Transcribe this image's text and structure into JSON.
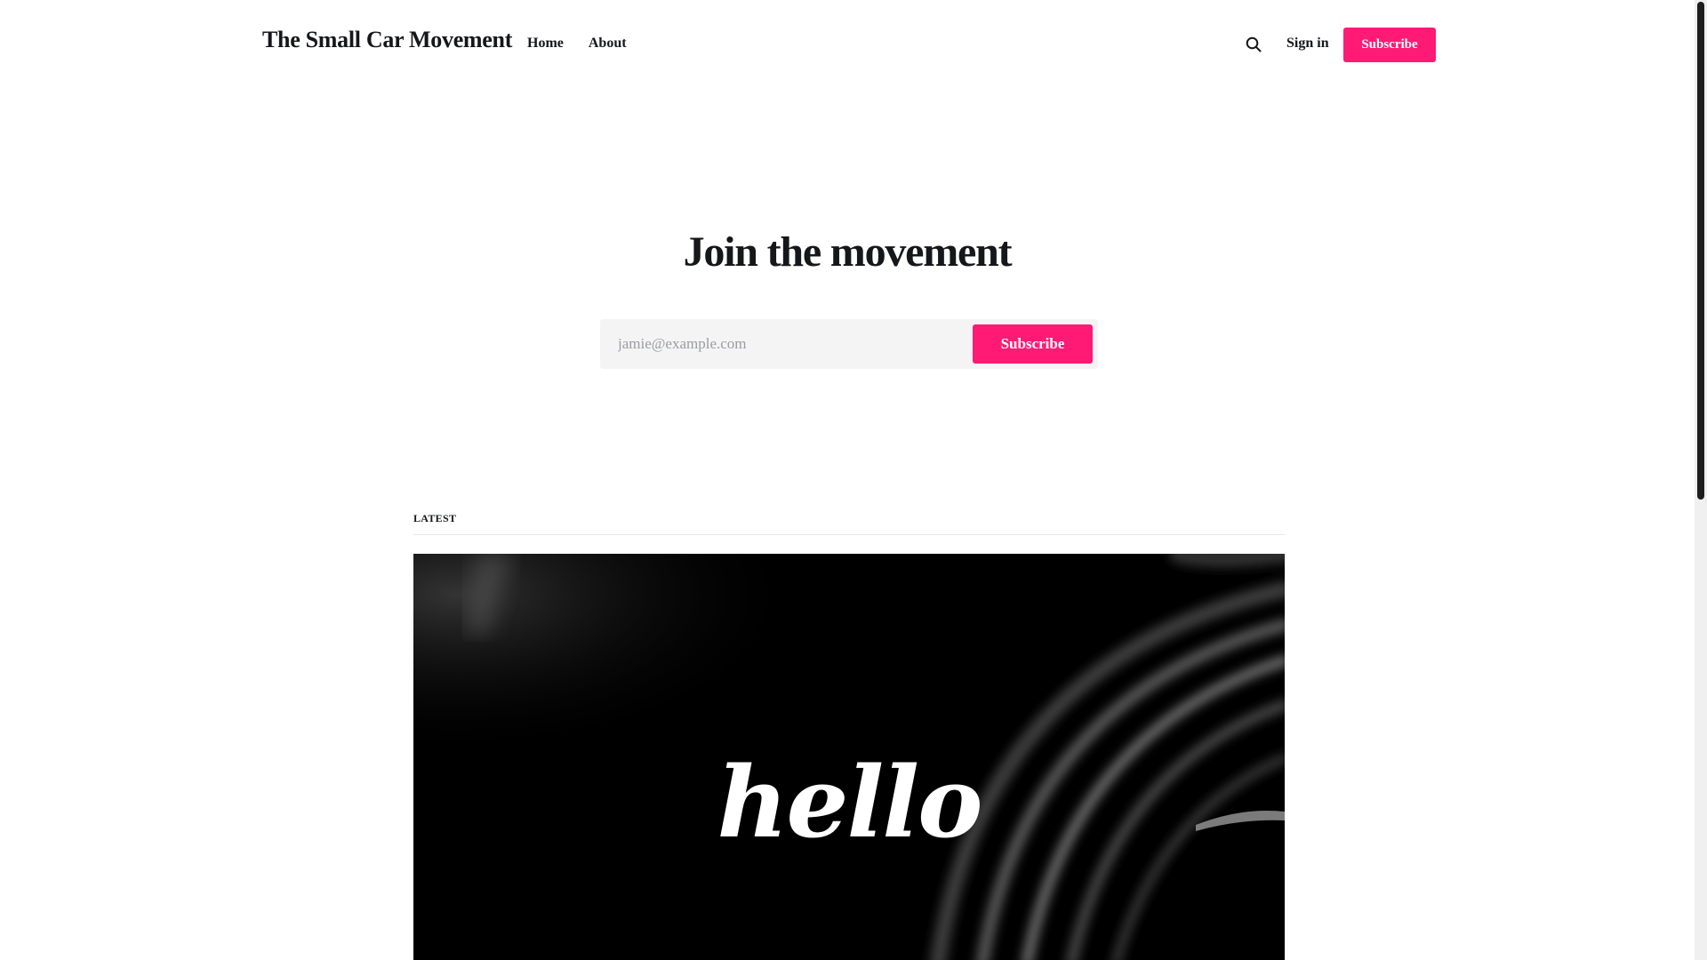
{
  "header": {
    "site_title": "The Small Car Movement",
    "nav": [
      {
        "label": "Home"
      },
      {
        "label": "About"
      }
    ],
    "search_icon": "search-icon",
    "sign_in_label": "Sign in",
    "subscribe_label": "Subscribe"
  },
  "hero": {
    "title": "Join the movement",
    "email_placeholder": "jamie@example.com",
    "email_value": "",
    "subscribe_label": "Subscribe"
  },
  "latest": {
    "section_label": "LATEST",
    "feature_image_text": "hello"
  },
  "colors": {
    "accent": "#ff1a75",
    "text": "#15171a",
    "input_bg": "#f4f4f5"
  }
}
